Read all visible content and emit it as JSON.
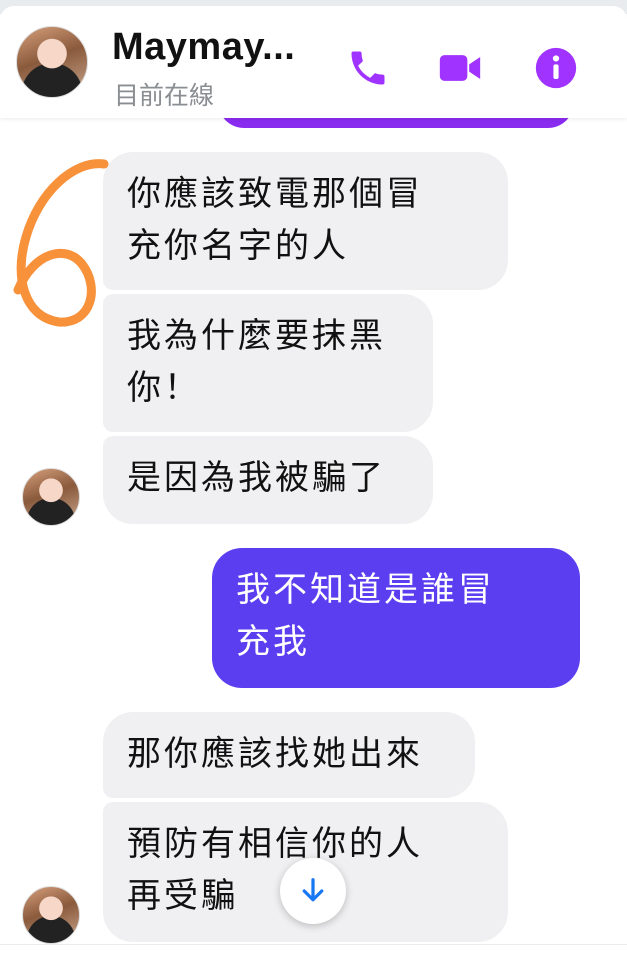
{
  "header": {
    "name": "Maymay...",
    "status": "目前在線",
    "icons": [
      "phone-icon",
      "video-camera-icon",
      "info-icon"
    ],
    "accent_color": "#a033ff"
  },
  "messages": [
    {
      "direction": "incoming",
      "text_lines": [
        "你應該致電那個冒",
        "充你名字的人"
      ]
    },
    {
      "direction": "incoming",
      "text_lines": [
        "我為什麼要抹黑",
        "你！"
      ]
    },
    {
      "direction": "incoming",
      "text_lines": [
        "是因為我被騙了"
      ]
    },
    {
      "direction": "outgoing",
      "text_lines": [
        "我不知道是誰冒",
        "充我"
      ]
    },
    {
      "direction": "incoming",
      "text_lines": [
        "那你應該找她出來"
      ]
    },
    {
      "direction": "incoming",
      "text_lines": [
        "預防有相信你的人",
        "再受騙"
      ]
    }
  ],
  "annotation": {
    "text": "6",
    "color": "#f7913a"
  },
  "scroll_button": {
    "icon": "arrow-down-icon"
  },
  "colors": {
    "incoming_bubble": "#f0f0f2",
    "outgoing_bubble": "#5b3ef0",
    "previous_outgoing_bubble": "#8a2bf0"
  }
}
